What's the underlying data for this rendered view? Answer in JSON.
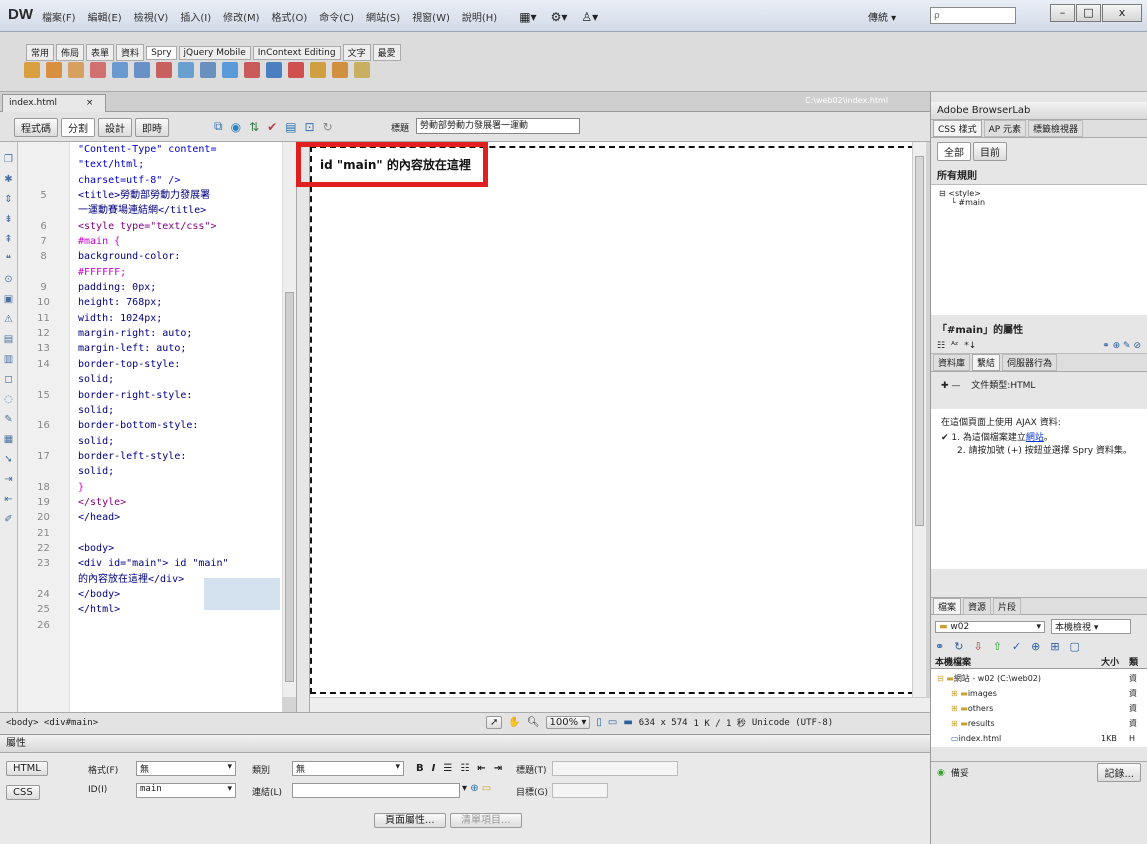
{
  "app": {
    "logo": "DW",
    "menu": [
      "檔案(F)",
      "編輯(E)",
      "檢視(V)",
      "插入(I)",
      "修改(M)",
      "格式(O)",
      "命令(C)",
      "網站(S)",
      "視窗(W)",
      "說明(H)"
    ],
    "workspace": "傳統",
    "search_placeholder": "ρ",
    "win_min": "–",
    "win_max": "□",
    "win_close": "x"
  },
  "insert_tabs": [
    "常用",
    "佈局",
    "表單",
    "資料",
    "Spry",
    "jQuery Mobile",
    "InContext Editing",
    "文字",
    "最愛"
  ],
  "document": {
    "tab_name": "index.html",
    "tab_close": "×",
    "path": "C:\\web02\\index.html",
    "view_buttons": [
      "程式碼",
      "分割",
      "設計",
      "即時"
    ],
    "title_label": "標題",
    "title_value": "勞動部勞動力發展署一運動"
  },
  "code_lines": [
    {
      "n": "",
      "text": "\"Content-Type\" content=",
      "color": "#0000cc"
    },
    {
      "n": "",
      "text": "\"text/html;",
      "color": "#0000cc"
    },
    {
      "n": "",
      "text": "charset=utf-8\" />",
      "color": "#0000cc"
    },
    {
      "n": "5",
      "text": "<title>勞動部勞動力發展署",
      "color": "#000080"
    },
    {
      "n": "",
      "text": "一運動賽場連結網</title>",
      "color": "#000080"
    },
    {
      "n": "6",
      "text": "<style type=\"text/css\">",
      "color": "#800080"
    },
    {
      "n": "7",
      "text": "#main {",
      "color": "#cc00cc"
    },
    {
      "n": "8",
      "text": "    background-color:",
      "color": "#000080"
    },
    {
      "n": "",
      "text": "#FFFFFF;",
      "color": "#cc00cc"
    },
    {
      "n": "9",
      "text": "    padding: 0px;",
      "color": "#000080"
    },
    {
      "n": "10",
      "text": "    height: 768px;",
      "color": "#000080"
    },
    {
      "n": "11",
      "text": "    width: 1024px;",
      "color": "#000080"
    },
    {
      "n": "12",
      "text": "    margin-right: auto;",
      "color": "#000080"
    },
    {
      "n": "13",
      "text": "    margin-left: auto;",
      "color": "#000080"
    },
    {
      "n": "14",
      "text": "    border-top-style:",
      "color": "#000080"
    },
    {
      "n": "",
      "text": "solid;",
      "color": "#000080"
    },
    {
      "n": "15",
      "text": "    border-right-style:",
      "color": "#000080"
    },
    {
      "n": "",
      "text": "solid;",
      "color": "#000080"
    },
    {
      "n": "16",
      "text": "    border-bottom-style:",
      "color": "#000080"
    },
    {
      "n": "",
      "text": "solid;",
      "color": "#000080"
    },
    {
      "n": "17",
      "text": "    border-left-style:",
      "color": "#000080"
    },
    {
      "n": "",
      "text": "solid;",
      "color": "#000080"
    },
    {
      "n": "18",
      "text": "}",
      "color": "#cc00cc"
    },
    {
      "n": "19",
      "text": "</style>",
      "color": "#800080"
    },
    {
      "n": "20",
      "text": "</head>",
      "color": "#000080"
    },
    {
      "n": "21",
      "text": "",
      "color": "#000080"
    },
    {
      "n": "22",
      "text": "<body>",
      "color": "#000080"
    },
    {
      "n": "23",
      "text": "<div id=\"main\"> id \"main\"",
      "color": "#000080"
    },
    {
      "n": "",
      "text": " 的內容放在這裡</div>",
      "color": "#000080"
    },
    {
      "n": "24",
      "text": "</body>",
      "color": "#000080"
    },
    {
      "n": "25",
      "text": "</html>",
      "color": "#000080"
    },
    {
      "n": "26",
      "text": "",
      "color": "#000080"
    }
  ],
  "design": {
    "content_text": "id \"main\" 的內容放在這裡"
  },
  "status": {
    "tag_path": "<body> <div#main>",
    "zoom": "100%",
    "size": "634 x 574",
    "download": "1 K / 1 秒",
    "encoding": "Unicode (UTF-8)"
  },
  "properties": {
    "title": "屬性",
    "html_btn": "HTML",
    "css_btn": "CSS",
    "format_label": "格式(F)",
    "format_value": "無",
    "class_label": "類別",
    "class_value": "無",
    "id_label": "ID(I)",
    "id_value": "main",
    "link_label": "連結(L)",
    "title_label": "標題(T)",
    "target_label": "目標(G)",
    "page_props_btn": "頁面屬性...",
    "list_item_btn": "清單項目..."
  },
  "right": {
    "browserlab": "Adobe BrowserLab",
    "css_tabs": [
      "CSS 樣式",
      "AP 元素",
      "標籤檢視器"
    ],
    "css_mode_all": "全部",
    "css_mode_current": "目前",
    "all_rules": "所有規則",
    "rule_style": "<style>",
    "rule_main": "#main",
    "props_title": "「#main」的屬性",
    "binding_tabs": [
      "資料庫",
      "繫結",
      "伺服器行為"
    ],
    "doc_type": "文件類型:HTML",
    "ajax_intro": "在這個頁面上使用 AJAX 資料:",
    "step1_prefix": "1. 為這個檔案建立",
    "step1_link": "網站",
    "step1_suffix": "。",
    "step2": "2. 請按加號 (+) 按鈕並選擇 Spry 資料集。",
    "files_tabs": [
      "檔案",
      "資源",
      "片段"
    ],
    "site_name": "w02",
    "site_view": "本機檢視",
    "local_files": "本機檔案",
    "size_col": "大小",
    "type_col": "類",
    "tree": [
      {
        "name": "網站 - w02 (C:\\web02)",
        "size": "",
        "type": "資",
        "indent": 0
      },
      {
        "name": "images",
        "size": "",
        "type": "資",
        "indent": 1
      },
      {
        "name": "others",
        "size": "",
        "type": "資",
        "indent": 1
      },
      {
        "name": "results",
        "size": "",
        "type": "資",
        "indent": 1
      },
      {
        "name": "index.html",
        "size": "1KB",
        "type": "H",
        "indent": 1
      }
    ],
    "footer_label": "備妥",
    "footer_btn": "記錄..."
  },
  "colors": {
    "highlight_box": "#e02020",
    "link": "#0033cc"
  }
}
